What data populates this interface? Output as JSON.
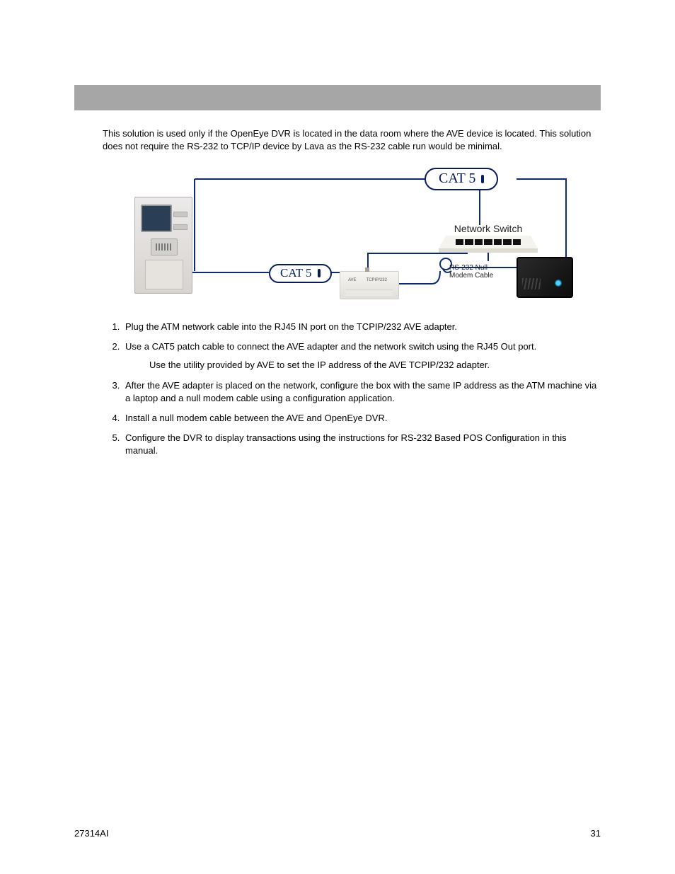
{
  "intro": "This solution is used only if the OpenEye DVR is located in the data room where the AVE device is located.  This solution does not require the RS-232 to TCP/IP device by Lava as the RS-232 cable run would be minimal.",
  "diagram": {
    "cat5_top": "CAT 5",
    "cat5_left": "CAT 5",
    "network_switch": "Network Switch",
    "rs232_line1": "RS-232 Null",
    "rs232_line2": "Modem Cable",
    "ave_label_left": "AVE",
    "ave_label_right": "TCPIP/232"
  },
  "steps": [
    "Plug the ATM network cable into the RJ45 IN port on the TCPIP/232 AVE adapter.",
    "Use a CAT5 patch cable to connect the AVE adapter and the network switch using the RJ45 Out port.",
    "After the AVE adapter is placed on the network, configure the box with the same IP address as the ATM machine via a laptop and a null modem cable using a configuration application.",
    "Install a null modem cable between the AVE and OpenEye DVR.",
    "Configure the DVR to display transactions using the instructions for RS-232 Based POS Configuration in this manual."
  ],
  "step2_sub": "Use the utility provided by AVE to set the IP address of the AVE TCPIP/232 adapter.",
  "footer": {
    "doc_id": "27314AI",
    "page_no": "31"
  }
}
